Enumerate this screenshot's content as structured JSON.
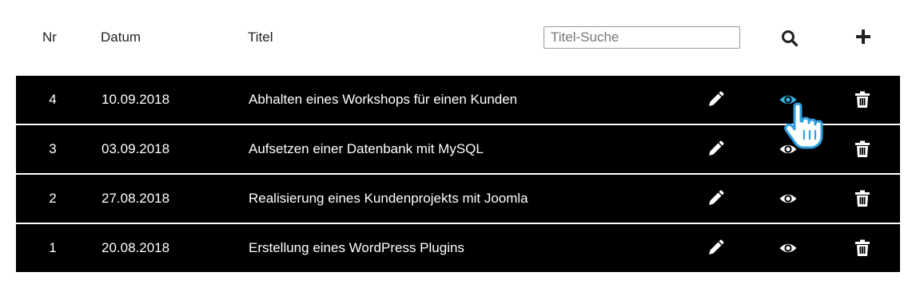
{
  "header": {
    "nr": "Nr",
    "datum": "Datum",
    "titel": "Titel",
    "search_placeholder": "Titel-Suche",
    "search_icon": "search-icon",
    "add_icon": "plus-icon"
  },
  "rows": [
    {
      "nr": "4",
      "datum": "10.09.2018",
      "titel": "Abhalten eines Workshops für einen Kunden",
      "view_active": true
    },
    {
      "nr": "3",
      "datum": "03.09.2018",
      "titel": "Aufsetzen einer Datenbank mit MySQL",
      "view_active": false
    },
    {
      "nr": "2",
      "datum": "27.08.2018",
      "titel": "Realisierung eines Kundenprojekts mit Joomla",
      "view_active": false
    },
    {
      "nr": "1",
      "datum": "20.08.2018",
      "titel": "Erstellung eines WordPress Plugins",
      "view_active": false
    }
  ],
  "row_actions": [
    "pencil-icon",
    "eye-icon",
    "trash-icon"
  ],
  "colors": {
    "row_background": "#000000",
    "row_text": "#ffffff",
    "view_active": "#3bb3e6",
    "cursor": "#2e9fe0"
  }
}
